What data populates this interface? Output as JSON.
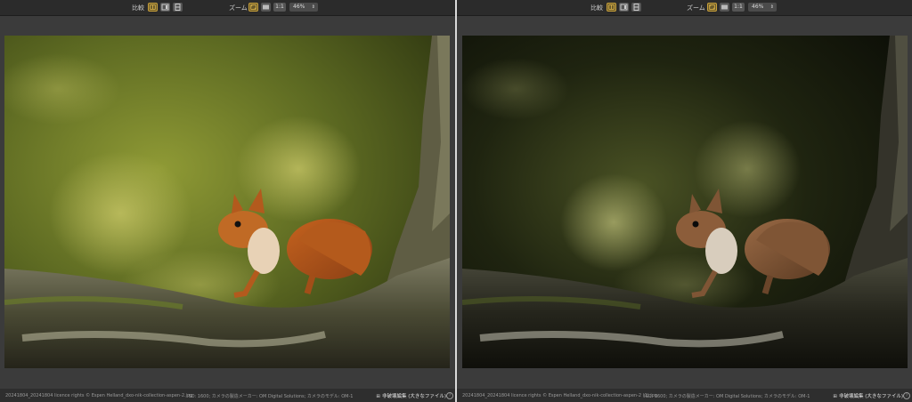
{
  "toolbar": {
    "compare_label": "比較",
    "zoom_label": "ズーム",
    "one_to_one": "1:1",
    "zoom_value": "46%"
  },
  "panes": [
    {
      "id": "before",
      "filename": "20241804_20241804 licence rights © Espen Helland_dxo-nik-collection-aspen-2.jpg",
      "meta": "ISO: 1600; カメラの製造メーカー: OM Digital Solutions; カメラのモデル: OM-1",
      "raw_label": "非破壊編集 (大きなファイル)"
    },
    {
      "id": "after",
      "filename": "20241804_20241804 licence rights © Espen Helland_dxo-nik-collection-aspen-2 (1).jpg",
      "meta": "ISO: 1600; カメラの製造メーカー: OM Digital Solutions; カメラのモデル: OM-1",
      "raw_label": "非破壊編集 (大きなファイル)"
    }
  ],
  "colors": {
    "accent": "#c9a13a",
    "divider": "#d9d9d9",
    "toolbar_bg": "#2b2b2b"
  }
}
